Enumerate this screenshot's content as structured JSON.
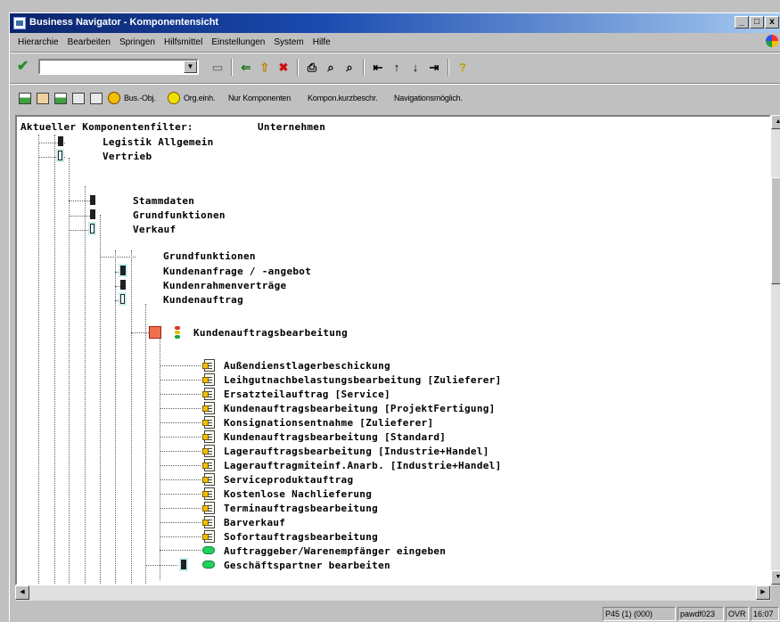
{
  "window": {
    "title": "Business Navigator - Komponentensicht",
    "buttons": [
      "_",
      "□",
      "x"
    ]
  },
  "menubar": {
    "items": [
      "Hierarchie",
      "Bearbeiten",
      "Springen",
      "Hilfsmittel",
      "Einstellungen",
      "System",
      "Hilfe"
    ]
  },
  "toolbar": {
    "command_field_value": "",
    "icons": [
      "enter-check-icon",
      "save-icon",
      "back-icon",
      "exit-icon",
      "cancel-icon",
      "print-icon",
      "find-icon",
      "find-next-icon",
      "first-page-icon",
      "prev-page-icon",
      "next-page-icon",
      "last-page-icon",
      "help-icon"
    ]
  },
  "app_toolbar": {
    "bus_obj_label": "Bus.-Obj.",
    "org_einh_label": "Org.einh.",
    "nur_komponenten_label": "Nur Komponenten",
    "kompon_kurzbeschr_label": "Kompon.kurzbeschr.",
    "navigationsmoeglich_label": "Navigationsmöglich."
  },
  "tree": {
    "filter_label": "Aktueller Komponentenfilter:",
    "filter_value": "Unternehmen",
    "level1": [
      "Legistik Allgemein",
      "Vertrieb"
    ],
    "level2": [
      "Stammdaten",
      "Grundfunktionen",
      "Verkauf"
    ],
    "level3": [
      "Grundfunktionen",
      "Kundenanfrage / -angebot",
      "Kundenrahmenverträge",
      "Kundenauftrag"
    ],
    "level4": "Kundenauftragsbearbeitung",
    "level5": [
      "Außendienstlagerbeschickung",
      "Leihgutnachbelastungsbearbeitung [Zulieferer]",
      "Ersatzteilauftrag [Service]",
      "Kundenauftragsbearbeitung [ProjektFertigung]",
      "Konsignationsentnahme [Zulieferer]",
      "Kundenauftragsbearbeitung [Standard]",
      "Lagerauftragsbearbeitung [Industrie+Handel]",
      "Lagerauftragmiteinf.Anarb. [Industrie+Handel]",
      "Serviceproduktauftrag",
      "Kostenlose Nachlieferung",
      "Terminauftragsbearbeitung",
      "Barverkauf",
      "Sofortauftragsbearbeitung",
      "Auftraggeber/Warenempfänger eingeben"
    ],
    "level4b": "Geschäftspartner bearbeiten"
  },
  "statusbar": {
    "system": "P45 (1) (000)",
    "server": "pawdf023",
    "mode": "OVR",
    "time": "16:07"
  },
  "colors": {
    "title_start": "#0a246a",
    "title_end": "#a6caf0",
    "window_bg": "#c0c0c0",
    "green_node": "#20d060",
    "highlight_node": "#c8f0f0"
  }
}
